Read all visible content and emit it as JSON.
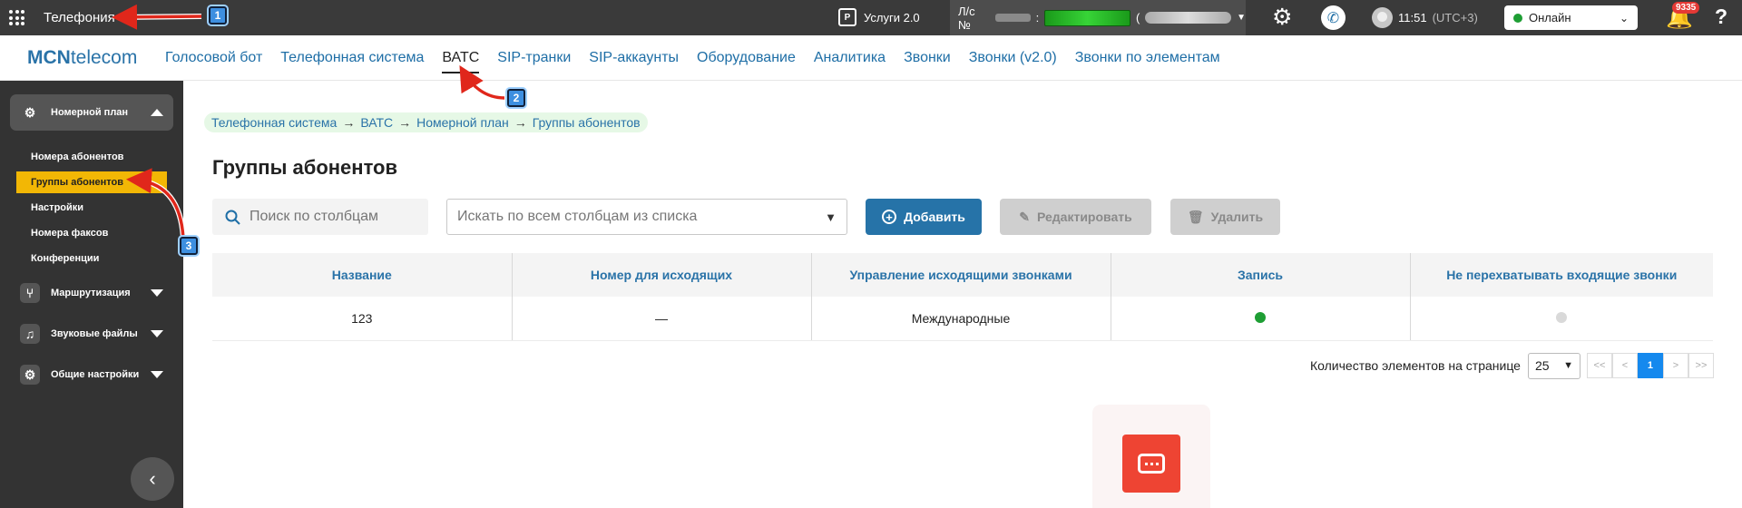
{
  "topbar": {
    "app_title": "Телефония",
    "services_label": "Услуги 2.0",
    "services_icon": "P",
    "account_prefix": "Л/с №",
    "account_colon": ":",
    "account_paren": "(",
    "time": "11:51",
    "timezone": "(UTC+3)",
    "status": "Онлайн",
    "notifications": "9335",
    "help": "?"
  },
  "navbar": {
    "logo_bold": "MCN",
    "logo_rest": "telecom",
    "items": [
      "Голосовой бот",
      "Телефонная система",
      "ВАТС",
      "SIP-транки",
      "SIP-аккаунты",
      "Оборудование",
      "Аналитика",
      "Звонки",
      "Звонки (v2.0)",
      "Звонки по элементам"
    ],
    "active_index": 2
  },
  "sidebar": {
    "open_group": "Номерной план",
    "sub_items": [
      "Номера абонентов",
      "Группы абонентов",
      "Настройки",
      "Номера факсов",
      "Конференции"
    ],
    "active_sub_index": 1,
    "groups": [
      "Маршрутизация",
      "Звуковые файлы",
      "Общие настройки"
    ]
  },
  "breadcrumb": [
    "Телефонная система",
    "ВАТС",
    "Номерной план",
    "Группы абонентов"
  ],
  "breadcrumb_sep": "→",
  "page_title": "Группы абонентов",
  "toolbar": {
    "search_placeholder": "Поиск по столбцам",
    "column_select": "Искать по всем столбцам из списка",
    "add": "Добавить",
    "edit": "Редактировать",
    "delete": "Удалить"
  },
  "table": {
    "headers": [
      "Название",
      "Номер для исходящих",
      "Управление исходящими звонками",
      "Запись",
      "Не перехватывать входящие звонки"
    ],
    "rows": [
      {
        "name": "123",
        "outgoing_number": "—",
        "call_control": "Международные",
        "record": true,
        "no_intercept": false
      }
    ]
  },
  "pagination": {
    "per_page_label": "Количество элементов на странице",
    "per_page": "25",
    "first": "<<",
    "prev": "<",
    "current": "1",
    "next": ">",
    "last": ">>"
  },
  "callouts": [
    "1",
    "2",
    "3"
  ],
  "colors": {
    "accent": "#2673a8",
    "active_sidebar": "#f2b705",
    "status_green": "#1e9e34",
    "record_on": "#1e9e34",
    "record_off": "#d9d9d9",
    "arrow_red": "#e0271b",
    "chat_red": "#ee4433"
  }
}
